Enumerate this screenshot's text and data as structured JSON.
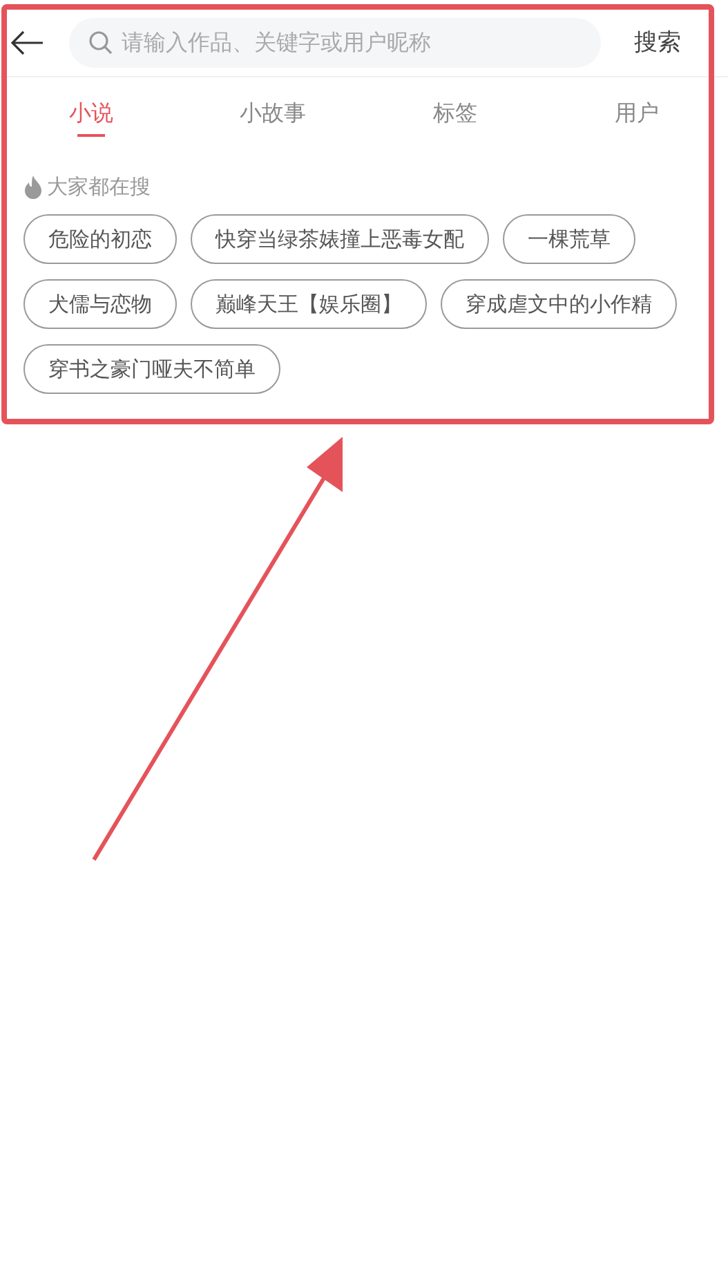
{
  "search": {
    "placeholder": "请输入作品、关键字或用户昵称",
    "button": "搜索"
  },
  "tabs": [
    {
      "label": "小说",
      "selected": true
    },
    {
      "label": "小故事",
      "selected": false
    },
    {
      "label": "标签",
      "selected": false
    },
    {
      "label": "用户",
      "selected": false
    }
  ],
  "hot_searches": {
    "title": "大家都在搜",
    "tags": [
      "危险的初恋",
      "快穿当绿茶婊撞上恶毒女配",
      "一棵荒草",
      "犬儒与恋物",
      "巅峰天王【娱乐圈】",
      "穿成虐文中的小作精",
      "穿书之豪门哑夫不简单"
    ]
  },
  "annotations": {
    "highlight_frame": true,
    "arrow": true
  }
}
